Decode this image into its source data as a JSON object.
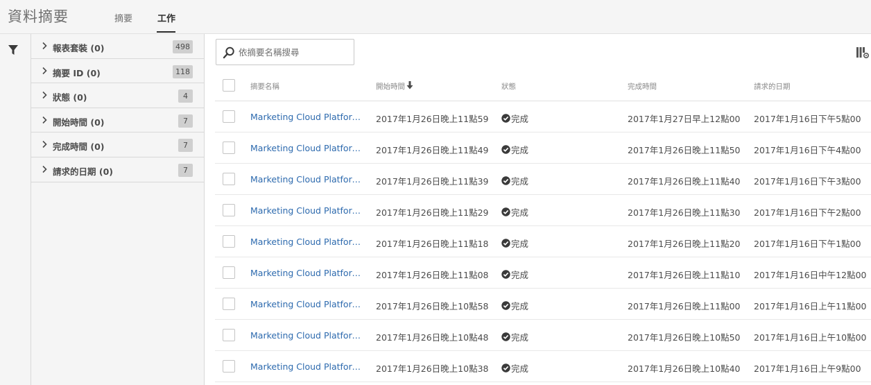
{
  "header": {
    "title": "資料摘要",
    "tabs": [
      {
        "label": "摘要",
        "active": false
      },
      {
        "label": "工作",
        "active": true
      }
    ]
  },
  "facets": [
    {
      "label": "報表套裝 (0)",
      "count": "498"
    },
    {
      "label": "摘要 ID (0)",
      "count": "118"
    },
    {
      "label": "狀態 (0)",
      "count": "4"
    },
    {
      "label": "開始時間 (0)",
      "count": "7"
    },
    {
      "label": "完成時間 (0)",
      "count": "7"
    },
    {
      "label": "請求的日期 (0)",
      "count": "7"
    }
  ],
  "search": {
    "placeholder": "依摘要名稱搜尋",
    "value": ""
  },
  "table": {
    "columns": {
      "name": "摘要名稱",
      "start": "開始時間",
      "status": "狀態",
      "done": "完成時間",
      "requested": "請求的日期"
    },
    "sort": {
      "column": "start",
      "direction": "descending"
    },
    "rows": [
      {
        "name": "Marketing Cloud Platform Co...",
        "start": "2017年1月26日晚上11點59",
        "status": "完成",
        "done": "2017年1月27日早上12點00",
        "requested": "2017年1月16日下午5點00"
      },
      {
        "name": "Marketing Cloud Platform Co...",
        "start": "2017年1月26日晚上11點49",
        "status": "完成",
        "done": "2017年1月26日晚上11點50",
        "requested": "2017年1月16日下午4點00"
      },
      {
        "name": "Marketing Cloud Platform Co...",
        "start": "2017年1月26日晚上11點39",
        "status": "完成",
        "done": "2017年1月26日晚上11點40",
        "requested": "2017年1月16日下午3點00"
      },
      {
        "name": "Marketing Cloud Platform Co...",
        "start": "2017年1月26日晚上11點29",
        "status": "完成",
        "done": "2017年1月26日晚上11點30",
        "requested": "2017年1月16日下午2點00"
      },
      {
        "name": "Marketing Cloud Platform Co...",
        "start": "2017年1月26日晚上11點18",
        "status": "完成",
        "done": "2017年1月26日晚上11點20",
        "requested": "2017年1月16日下午1點00"
      },
      {
        "name": "Marketing Cloud Platform Co...",
        "start": "2017年1月26日晚上11點08",
        "status": "完成",
        "done": "2017年1月26日晚上11點10",
        "requested": "2017年1月16日中午12點00"
      },
      {
        "name": "Marketing Cloud Platform Co...",
        "start": "2017年1月26日晚上10點58",
        "status": "完成",
        "done": "2017年1月26日晚上11點00",
        "requested": "2017年1月16日上午11點00"
      },
      {
        "name": "Marketing Cloud Platform Co...",
        "start": "2017年1月26日晚上10點48",
        "status": "完成",
        "done": "2017年1月26日晚上10點50",
        "requested": "2017年1月16日上午10點00"
      },
      {
        "name": "Marketing Cloud Platform Co...",
        "start": "2017年1月26日晚上10點38",
        "status": "完成",
        "done": "2017年1月26日晚上10點40",
        "requested": "2017年1月16日上午9點00"
      }
    ]
  },
  "icons": {
    "filter": "filter-icon",
    "search": "search-icon",
    "column_settings": "column-settings-icon",
    "status_complete": "check-circle-icon",
    "sort": "arrow-down-icon"
  },
  "colors": {
    "link": "#2d6aae",
    "panel": "#f5f5f5",
    "badge": "#cfcfcf"
  }
}
